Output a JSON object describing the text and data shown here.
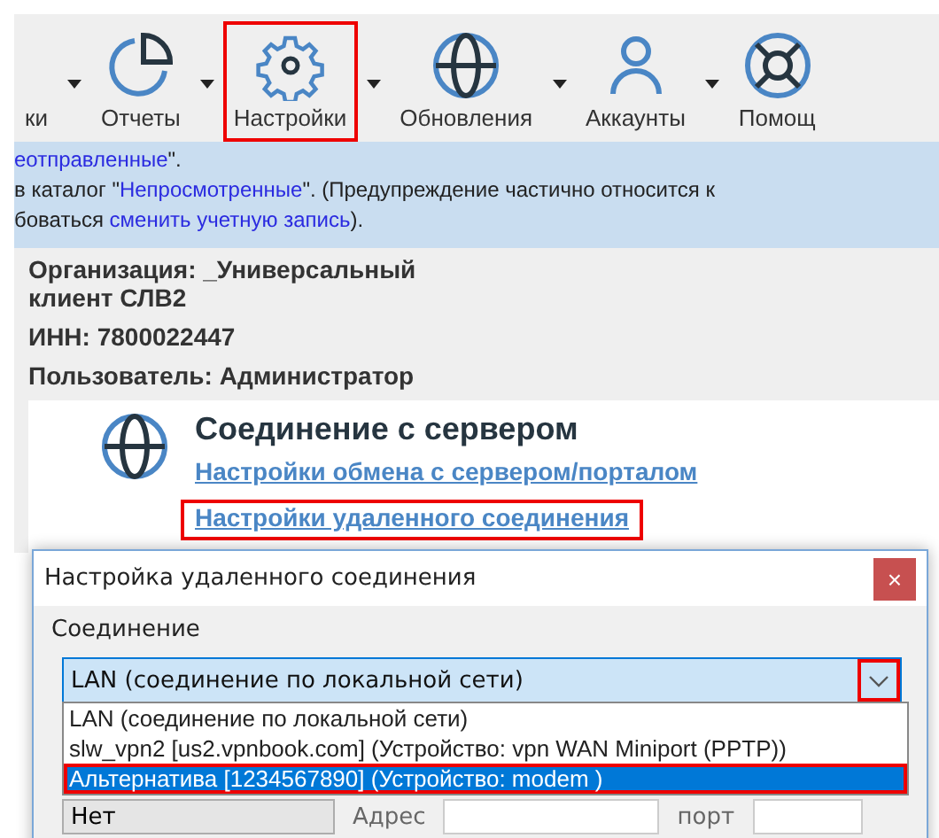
{
  "toolbar": {
    "items": [
      {
        "label": "ки",
        "highlighted": false
      },
      {
        "label": "Отчеты",
        "highlighted": false
      },
      {
        "label": "Настройки",
        "highlighted": true
      },
      {
        "label": "Обновления",
        "highlighted": false
      },
      {
        "label": "Аккаунты",
        "highlighted": false
      },
      {
        "label": "Помощ",
        "highlighted": false
      }
    ]
  },
  "notice": {
    "lines": [
      [
        {
          "kind": "link",
          "text": "еотправленные"
        },
        {
          "kind": "text",
          "text": "\"."
        }
      ],
      [
        {
          "kind": "text",
          "text": "в каталог \""
        },
        {
          "kind": "link",
          "text": "Непросмотренные"
        },
        {
          "kind": "text",
          "text": "\". (Предупреждение частично относится к"
        }
      ],
      [
        {
          "kind": "text",
          "text": "боваться "
        },
        {
          "kind": "link",
          "text": "сменить учетную запись"
        },
        {
          "kind": "text",
          "text": ")."
        }
      ]
    ]
  },
  "info": [
    "Организация: _Универсальный клиент СЛВ2",
    "ИНН: 7800022447",
    "Пользователь: Администратор"
  ],
  "section": {
    "title": "Соединение с сервером",
    "links": [
      {
        "label": "Настройки обмена с сервером/порталом",
        "highlighted": false
      },
      {
        "label": "Настройки удаленного соединения",
        "highlighted": true
      }
    ]
  },
  "dialog": {
    "title": "Настройка удаленного соединения",
    "close": "×",
    "group": "Соединение",
    "combo": {
      "value": "LAN (соединение по локальной сети)",
      "arrow_highlighted": true
    },
    "options": [
      {
        "label": "LAN (соединение по локальной сети)",
        "selected": false,
        "highlighted": false
      },
      {
        "label": "slw_vpn2 [us2.vpnbook.com] (Устройство: vpn WAN Miniport (PPTP))",
        "selected": false,
        "highlighted": false
      },
      {
        "label": "Альтернатива [1234567890] (Устройство: modem )",
        "selected": true,
        "highlighted": true
      }
    ],
    "proxy_combo": "Нет",
    "address_label": "Адрес",
    "port_label": "порт"
  }
}
